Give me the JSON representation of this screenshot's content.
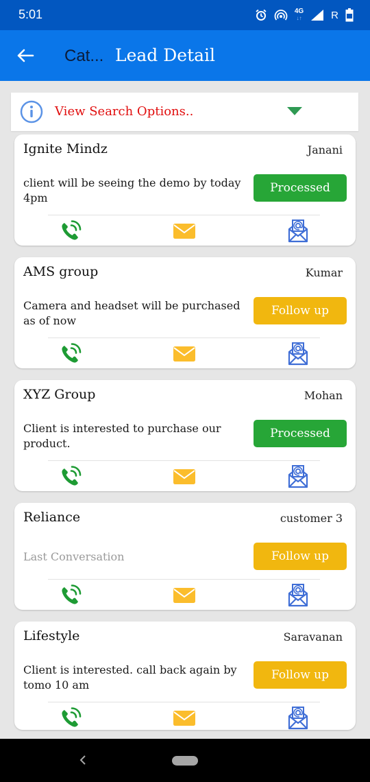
{
  "status_bar": {
    "time": "5:01",
    "icons": [
      "alarm-icon",
      "hotspot-icon",
      "4g-icon",
      "signal-icon",
      "roaming-icon",
      "battery-icon"
    ],
    "network_label": "4G",
    "roaming_label": "R"
  },
  "app_bar": {
    "back_icon": "arrow-left-icon",
    "category_title": "Cat...",
    "title": "Lead Detail"
  },
  "search": {
    "label": "View Search Options..",
    "icon": "info-icon",
    "toggle_icon": "dropdown-triangle-icon"
  },
  "colors": {
    "status_bar": "#0257c0",
    "app_bar": "#0a76e9",
    "processed": "#27a637",
    "follow_up": "#f1b70f",
    "call_icon": "#1e9b34",
    "mail_icon": "#fbbd2c",
    "email_icon": "#3f6ed6",
    "search_label": "#e10e0e"
  },
  "leads": [
    {
      "company": "Ignite Mindz",
      "contact": "Janani",
      "note": "client will be seeing the demo by today 4pm",
      "note_is_placeholder": false,
      "status": "Processed",
      "status_type": "processed"
    },
    {
      "company": "AMS group",
      "contact": "Kumar",
      "note": "Camera and headset will be purchased as of now",
      "note_is_placeholder": false,
      "status": "Follow up",
      "status_type": "follow_up"
    },
    {
      "company": "XYZ Group",
      "contact": "Mohan",
      "note": "Client is interested to purchase our product.",
      "note_is_placeholder": false,
      "status": "Processed",
      "status_type": "processed"
    },
    {
      "company": "Reliance",
      "contact": "customer 3",
      "note": "Last Conversation",
      "note_is_placeholder": true,
      "status": "Follow up",
      "status_type": "follow_up"
    },
    {
      "company": "Lifestyle",
      "contact": "Saravanan",
      "note": "Client is interested. call back again by tomo 10 am",
      "note_is_placeholder": false,
      "status": "Follow up",
      "status_type": "follow_up"
    }
  ],
  "actions": {
    "call_icon": "phone-call-icon",
    "mail_icon": "envelope-icon",
    "email_icon": "open-email-at-icon"
  },
  "nav_bar": {
    "back_icon": "nav-back-icon",
    "home_icon": "nav-home-pill"
  }
}
